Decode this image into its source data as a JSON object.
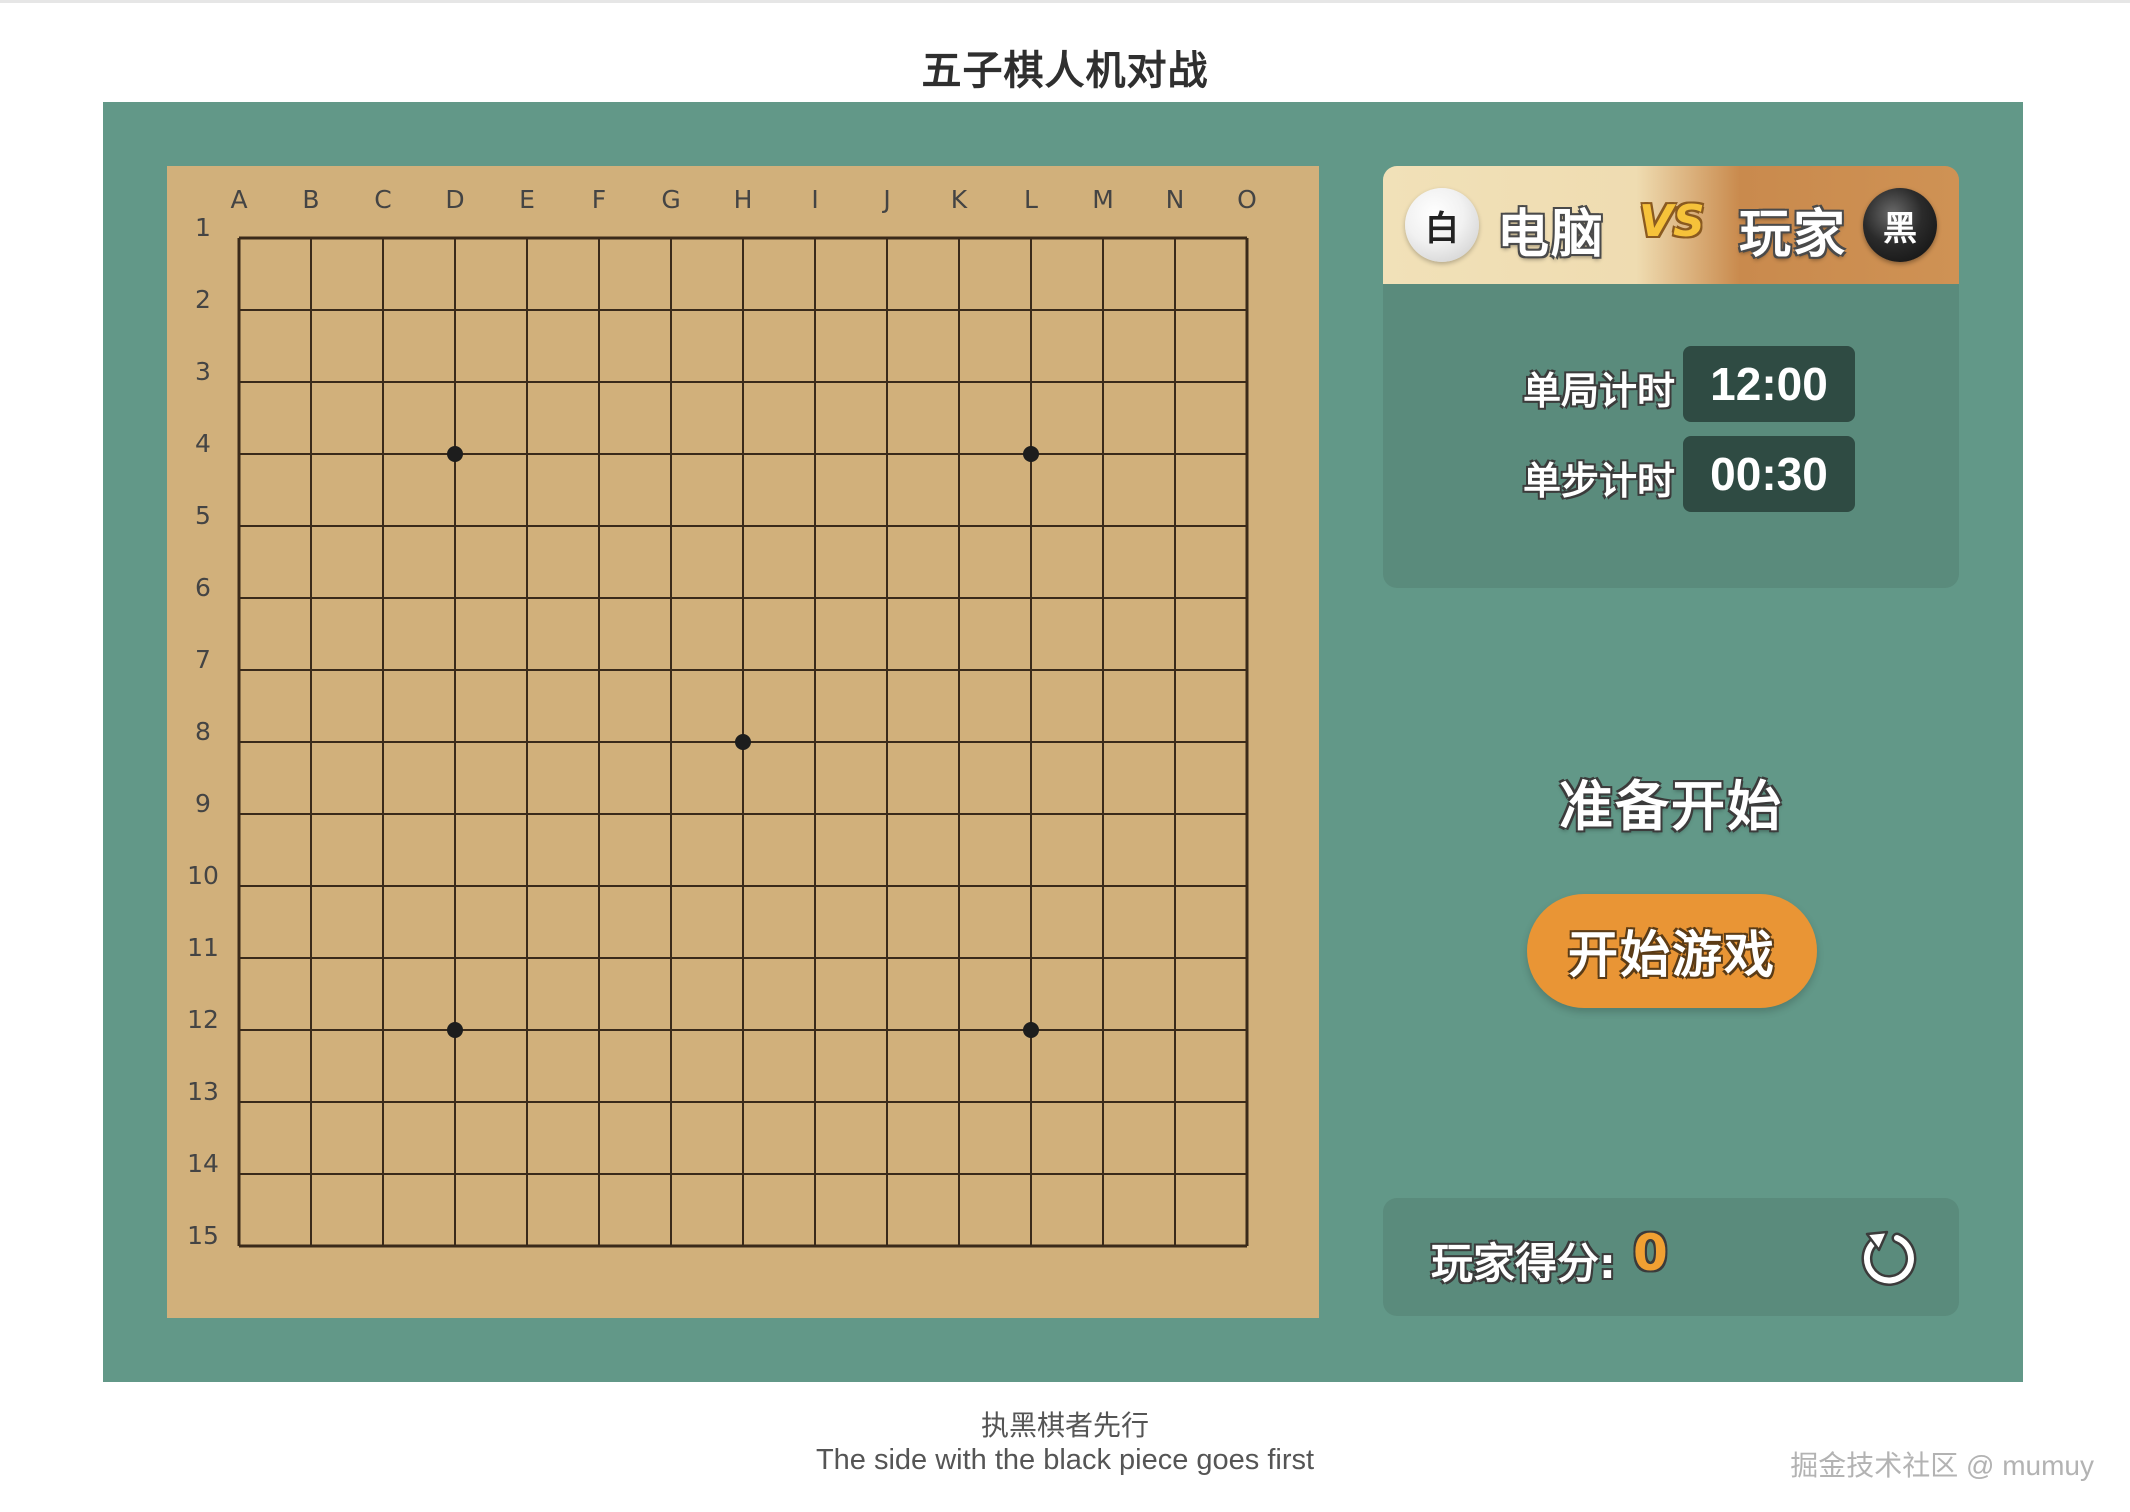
{
  "page": {
    "title": "五子棋人机对战",
    "caption_cn": "执黑棋者先行",
    "caption_en": "The side with the black piece goes first",
    "watermark": "掘金技术社区 @ mumuy"
  },
  "board": {
    "columns": [
      "A",
      "B",
      "C",
      "D",
      "E",
      "F",
      "G",
      "H",
      "I",
      "J",
      "K",
      "L",
      "M",
      "N",
      "O"
    ],
    "rows": [
      "1",
      "2",
      "3",
      "4",
      "5",
      "6",
      "7",
      "8",
      "9",
      "10",
      "11",
      "12",
      "13",
      "14",
      "15"
    ],
    "star_points": [
      "D4",
      "L4",
      "H8",
      "D12",
      "L12"
    ],
    "stones": []
  },
  "players": {
    "computer": {
      "stone_label": "白",
      "name": "电脑"
    },
    "vs_label": "VS",
    "player": {
      "stone_label": "黑",
      "name": "玩家"
    }
  },
  "timers": {
    "game_label": "单局计时",
    "game_value": "12:00",
    "move_label": "单步计时",
    "move_value": "00:30"
  },
  "status": "准备开始",
  "start_button_label": "开始游戏",
  "score": {
    "label": "玩家得分:",
    "value": "0"
  },
  "colors": {
    "background": "#629888",
    "board": "#d1b07b",
    "panel": "#5a8b7c",
    "timer_bg": "#2f4b43",
    "accent_orange": "#e99535",
    "score_orange": "#f0a032"
  },
  "icons": {
    "reset": "refresh-icon"
  }
}
